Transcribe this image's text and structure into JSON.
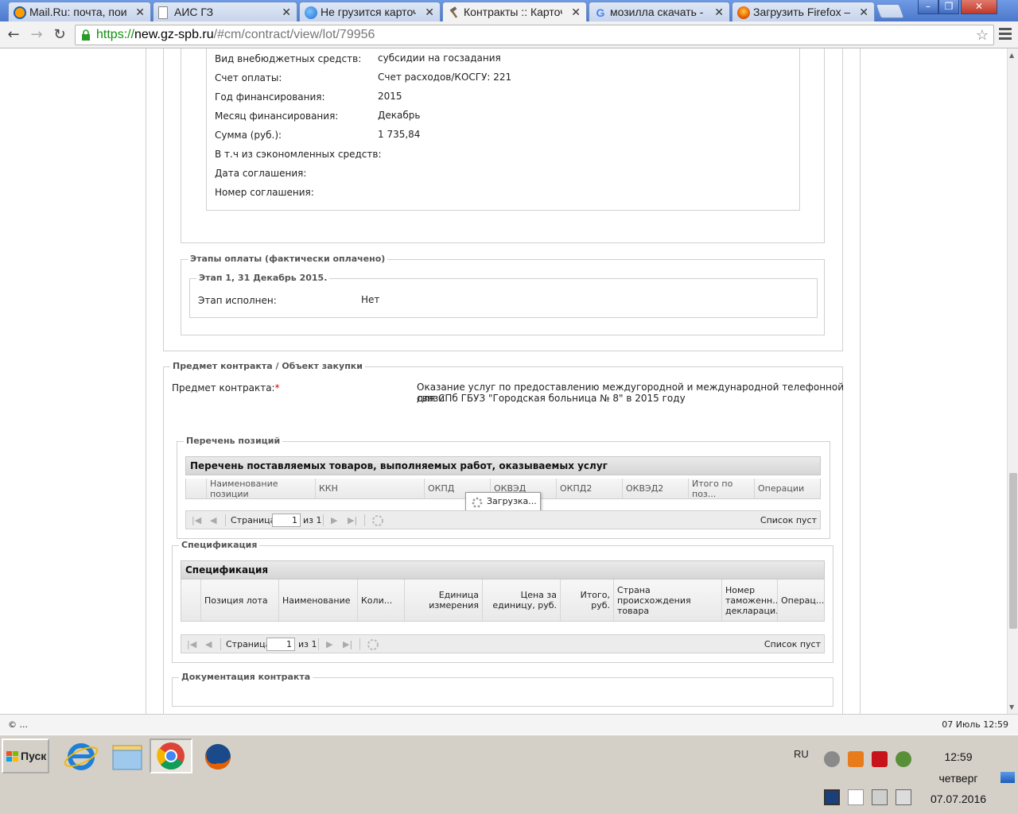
{
  "browser": {
    "tabs": [
      {
        "title": "Mail.Ru: почта, поиск",
        "icon_color": "#ff9c00"
      },
      {
        "title": "АИС ГЗ",
        "icon_color": "#ffffff"
      },
      {
        "title": "Не грузится карточка",
        "icon_color": "#2a7ad8"
      },
      {
        "title": "Контракты :: Карточка",
        "icon_color": "#888888"
      },
      {
        "title": "мозилла скачать - Google",
        "icon_color": "#4285f4"
      },
      {
        "title": "Загрузить Firefox — Mozilla",
        "icon_color": "#e66000"
      }
    ],
    "tab_close": "✕",
    "window_buttons": {
      "minimize": "–",
      "maximize": "❐",
      "close": "✕"
    },
    "nav": {
      "back": "←",
      "forward": "→",
      "reload": "↻"
    },
    "url": {
      "scheme": "https://",
      "host": "new.gz-spb.ru",
      "path": "/#cm/contract/view/lot/79956"
    },
    "star": "☆"
  },
  "financing": {
    "rows": [
      {
        "label": "Вид внебюджетных средств:",
        "value": "субсидии на госзадания"
      },
      {
        "label": "Счет оплаты:",
        "value": "Счет расходов/КОСГУ: 221"
      },
      {
        "label": "Год финансирования:",
        "value": "2015"
      },
      {
        "label": "Месяц финансирования:",
        "value": "Декабрь"
      },
      {
        "label": "Сумма (руб.):",
        "value": "1 735,84"
      },
      {
        "label": "В т.ч из сэкономленных средств:",
        "value": ""
      },
      {
        "label": "Дата соглашения:",
        "value": ""
      },
      {
        "label": "Номер соглашения:",
        "value": ""
      }
    ]
  },
  "payment_stages": {
    "legend": "Этапы оплаты (фактически оплачено)",
    "stage_legend": "Этап 1, 31 Декабрь 2015.",
    "label": "Этап исполнен:",
    "value": "Нет"
  },
  "subject": {
    "legend": "Предмет контракта / Объект закупки",
    "label": "Предмет контракта:",
    "required_mark": "*",
    "value_line1": "Оказание услуг по предоставлению междугородной и международной телефонной связи",
    "value_line2": "для СПб ГБУЗ \"Городская больница № 8\" в 2015 году"
  },
  "positions": {
    "legend": "Перечень позиций",
    "grid_title": "Перечень поставляемых товаров, выполняемых работ, оказываемых услуг",
    "columns": [
      "Наименование позиции",
      "ККН",
      "ОКПД",
      "ОКВЭД",
      "ОКПД2",
      "ОКВЭД2",
      "Итого по поз...",
      "Операции"
    ],
    "loading": "Загрузка...",
    "pager": {
      "page_label": "Страница",
      "page_value": "1",
      "of_label": "из 1",
      "empty": "Список пуст"
    }
  },
  "specification": {
    "legend": "Спецификация",
    "grid_title": "Спецификация",
    "columns": [
      "Позиция лота",
      "Наименование",
      "Коли...",
      "Единица измерения",
      "Цена за единицу, руб.",
      "Итого, руб.",
      "Страна происхождения товара",
      "Номер таможенн... деклараци...",
      "Операц..."
    ],
    "pager": {
      "page_label": "Страница",
      "page_value": "1",
      "of_label": "из 1",
      "empty": "Список пуст"
    }
  },
  "documentation": {
    "legend": "Документация контракта"
  },
  "status": {
    "left": "© ...",
    "right": "07 Июль 12:59"
  },
  "taskbar": {
    "start_label": "Пуск",
    "lang": "RU",
    "time": "12:59",
    "weekday": "четверг",
    "date": "07.07.2016"
  }
}
